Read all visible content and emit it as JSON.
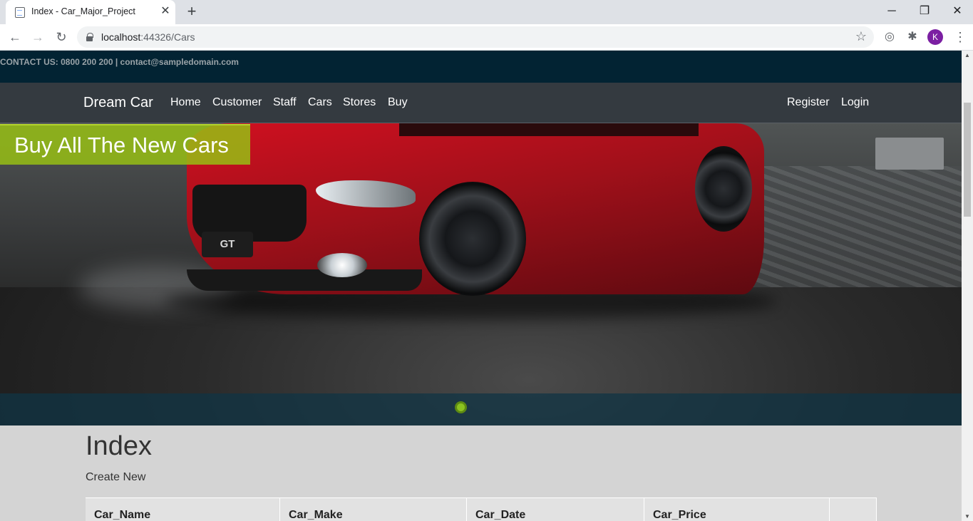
{
  "browser": {
    "tab_title": "Index - Car_Major_Project",
    "url_host": "localhost",
    "url_path": ":44326/Cars",
    "profile_initial": "K"
  },
  "site": {
    "contact_text": "CONTACT US: 0800 200 200 | contact@sampledomain.com",
    "brand": "Dream Car",
    "nav": [
      {
        "label": "Home"
      },
      {
        "label": "Customer"
      },
      {
        "label": "Staff"
      },
      {
        "label": "Cars"
      },
      {
        "label": "Stores"
      },
      {
        "label": "Buy"
      }
    ],
    "auth": {
      "register": "Register",
      "login": "Login"
    },
    "hero": {
      "caption": "Buy All The New Cars",
      "badge": "GT",
      "colors": {
        "caption_bg": "#96be14",
        "indicator": "#8bc220",
        "band": "#103444"
      }
    }
  },
  "main": {
    "title": "Index",
    "create_link": "Create New",
    "table": {
      "columns": [
        "Car_Name",
        "Car_Make",
        "Car_Date",
        "Car_Price",
        ""
      ]
    }
  }
}
